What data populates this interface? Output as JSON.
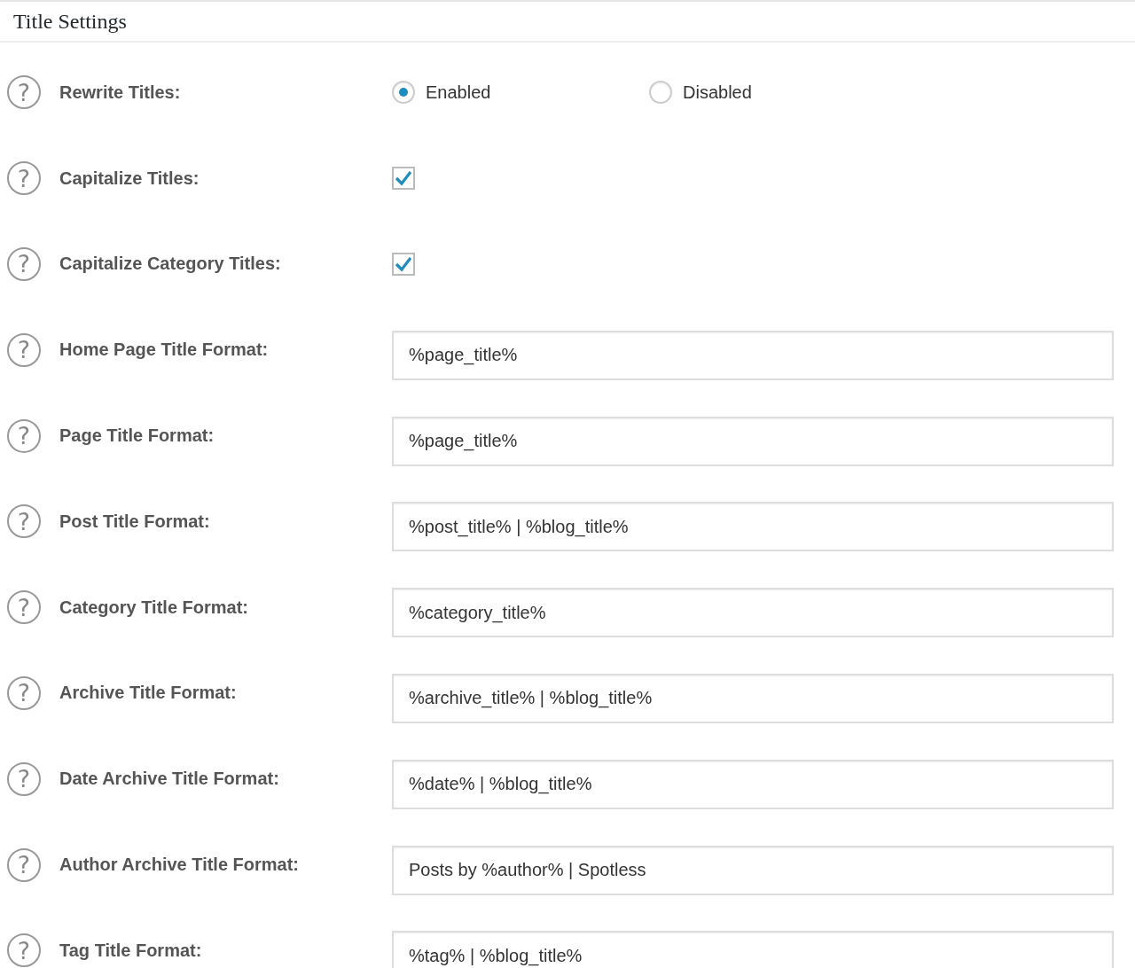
{
  "section": {
    "title": "Title Settings"
  },
  "settings": [
    {
      "kind": "radio",
      "help": "?",
      "label": "Rewrite Titles:",
      "options": [
        {
          "label": "Enabled",
          "selected": true
        },
        {
          "label": "Disabled",
          "selected": false
        }
      ]
    },
    {
      "kind": "checkbox",
      "help": "?",
      "label": "Capitalize Titles:",
      "checked": true
    },
    {
      "kind": "checkbox",
      "help": "?",
      "label": "Capitalize Category Titles:",
      "checked": true
    },
    {
      "kind": "text",
      "help": "?",
      "label": "Home Page Title Format:",
      "value": "%page_title%"
    },
    {
      "kind": "text",
      "help": "?",
      "label": "Page Title Format:",
      "value": "%page_title%"
    },
    {
      "kind": "text",
      "help": "?",
      "label": "Post Title Format:",
      "value": "%post_title% | %blog_title%"
    },
    {
      "kind": "text",
      "help": "?",
      "label": "Category Title Format:",
      "value": "%category_title%"
    },
    {
      "kind": "text",
      "help": "?",
      "label": "Archive Title Format:",
      "value": "%archive_title% | %blog_title%"
    },
    {
      "kind": "text",
      "help": "?",
      "label": "Date Archive Title Format:",
      "value": "%date% | %blog_title%"
    },
    {
      "kind": "text",
      "help": "?",
      "label": "Author Archive Title Format:",
      "value": "Posts by %author% | Spotless"
    },
    {
      "kind": "text",
      "help": "?",
      "label": "Tag Title Format:",
      "value": "%tag% | %blog_title%"
    }
  ]
}
